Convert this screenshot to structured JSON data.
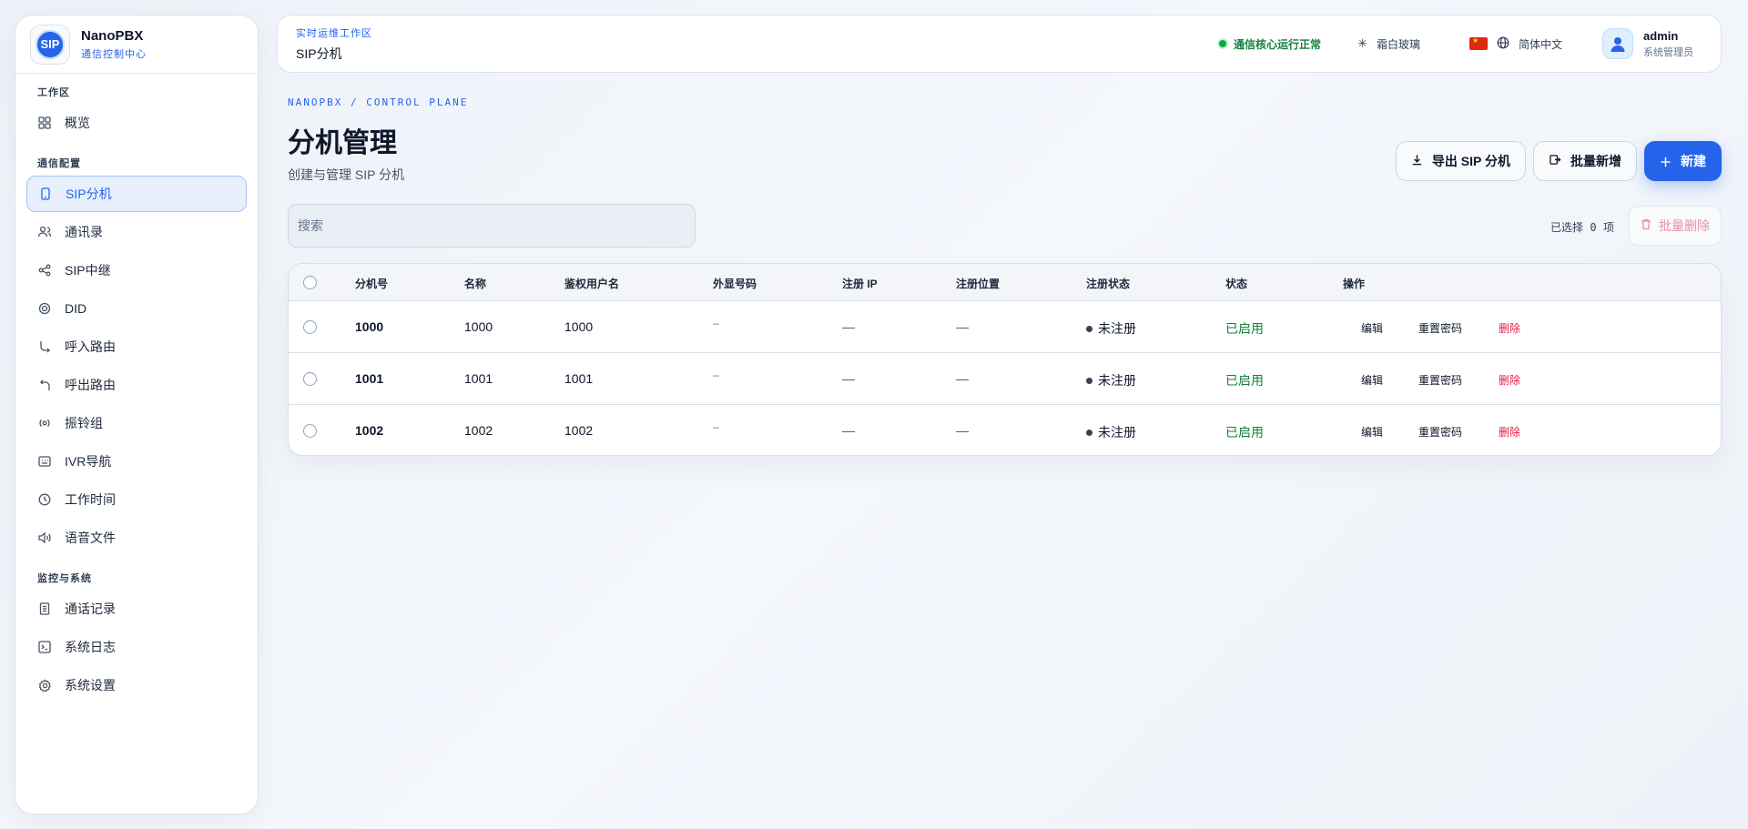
{
  "brand": {
    "logo_text": "SIP",
    "name": "NanoPBX",
    "subtitle": "通信控制中心"
  },
  "sidebar": {
    "sections": [
      {
        "label": "工作区",
        "items": [
          {
            "label": "概览",
            "icon": "grid-icon"
          }
        ]
      },
      {
        "label": "通信配置",
        "items": [
          {
            "label": "SIP分机",
            "icon": "phone-icon",
            "active": true
          },
          {
            "label": "通讯录",
            "icon": "contacts-icon"
          },
          {
            "label": "SIP中继",
            "icon": "share-icon"
          },
          {
            "label": "DID",
            "icon": "did-icon"
          },
          {
            "label": "呼入路由",
            "icon": "inbound-route-icon"
          },
          {
            "label": "呼出路由",
            "icon": "outbound-route-icon"
          },
          {
            "label": "振铃组",
            "icon": "ring-group-icon"
          },
          {
            "label": "IVR导航",
            "icon": "ivr-icon"
          },
          {
            "label": "工作时间",
            "icon": "clock-icon"
          },
          {
            "label": "语音文件",
            "icon": "speaker-icon"
          }
        ]
      },
      {
        "label": "监控与系统",
        "items": [
          {
            "label": "通话记录",
            "icon": "document-icon"
          },
          {
            "label": "系统日志",
            "icon": "terminal-icon"
          },
          {
            "label": "系统设置",
            "icon": "gear-icon"
          }
        ]
      }
    ]
  },
  "topbar": {
    "eyebrow": "实时运维工作区",
    "title": "SIP分机",
    "status": "通信核心运行正常",
    "theme": "霜白玻璃",
    "language": "简体中文",
    "user": {
      "name": "admin",
      "role": "系统管理员"
    }
  },
  "page": {
    "breadcrumb": "NANOPBX / CONTROL PLANE",
    "title": "分机管理",
    "description": "创建与管理 SIP 分机",
    "actions": {
      "export": "导出 SIP 分机",
      "batch_add": "批量新增",
      "create": "新建"
    },
    "search_placeholder": "搜索",
    "selection": {
      "prefix": "已选择",
      "count": "0",
      "suffix": "项"
    },
    "batch_delete": "批量删除"
  },
  "table": {
    "columns": [
      "分机号",
      "名称",
      "鉴权用户名",
      "外显号码",
      "注册 IP",
      "注册位置",
      "注册状态",
      "状态",
      "操作"
    ],
    "rows": [
      {
        "ext": "1000",
        "name": "1000",
        "auth": "1000",
        "cid": "–",
        "ip": "—",
        "loc": "—",
        "reg": "未注册",
        "status": "已启用"
      },
      {
        "ext": "1001",
        "name": "1001",
        "auth": "1001",
        "cid": "–",
        "ip": "—",
        "loc": "—",
        "reg": "未注册",
        "status": "已启用"
      },
      {
        "ext": "1002",
        "name": "1002",
        "auth": "1002",
        "cid": "–",
        "ip": "—",
        "loc": "—",
        "reg": "未注册",
        "status": "已启用"
      }
    ],
    "row_actions": {
      "edit": "编辑",
      "reset": "重置密码",
      "delete": "删除"
    }
  },
  "colors": {
    "accent": "#2563eb",
    "success": "#15803d",
    "danger": "#e11d48"
  }
}
